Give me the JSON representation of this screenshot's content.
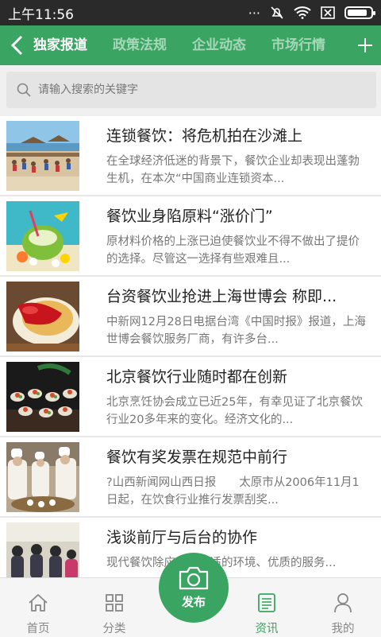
{
  "statusbar": {
    "time": "上午11:56"
  },
  "navbar": {
    "tabs": [
      {
        "label": "独家报道"
      },
      {
        "label": "政策法规"
      },
      {
        "label": "企业动态"
      },
      {
        "label": "市场行情"
      }
    ],
    "accent": "#3aa563"
  },
  "search": {
    "placeholder": "请输入搜索的关键字"
  },
  "articles": [
    {
      "title": "连锁餐饮：将危机拍在沙滩上",
      "summary": "在全球经济低迷的背景下，餐饮企业却表现出蓬勃生机，在本次“中国商业连锁资本...",
      "image": "beach-photo"
    },
    {
      "title": "餐饮业身陷原料“涨价门”",
      "summary": "原材料价格的上涨已迫使餐饮业不得不做出了提价的选择。尽管这一选择有些艰难且...",
      "image": "coconut-drink-photo"
    },
    {
      "title": "台资餐饮业抢进上海世博会 称即...",
      "summary": "中新网12月28日电据台湾《中国时报》报道，上海世博会餐饮服务厂商，有许多台...",
      "image": "food-plate-photo"
    },
    {
      "title": "北京餐饮行业随时都在创新",
      "summary": "北京烹饪协会成立已近25年，有幸见证了北京餐饮行业20多年来的变化。经济文化的...",
      "image": "banquet-dishes-photo"
    },
    {
      "title": "餐饮有奖发票在规范中前行",
      "summary": "?山西新闻网山西日报　　太原市从2006年11月1日起，在饮食行业推行发票刮奖...",
      "image": "chefs-kitchen-photo"
    },
    {
      "title": "浅谈前厅与后台的协作",
      "summary": "现代餐饮除应具有舒适的环境、优质的服务...",
      "image": "dining-hall-photo"
    }
  ],
  "bottom_nav": {
    "home": "首页",
    "category": "分类",
    "publish": "发布",
    "news": "资讯",
    "mine": "我的",
    "active": "资讯"
  }
}
